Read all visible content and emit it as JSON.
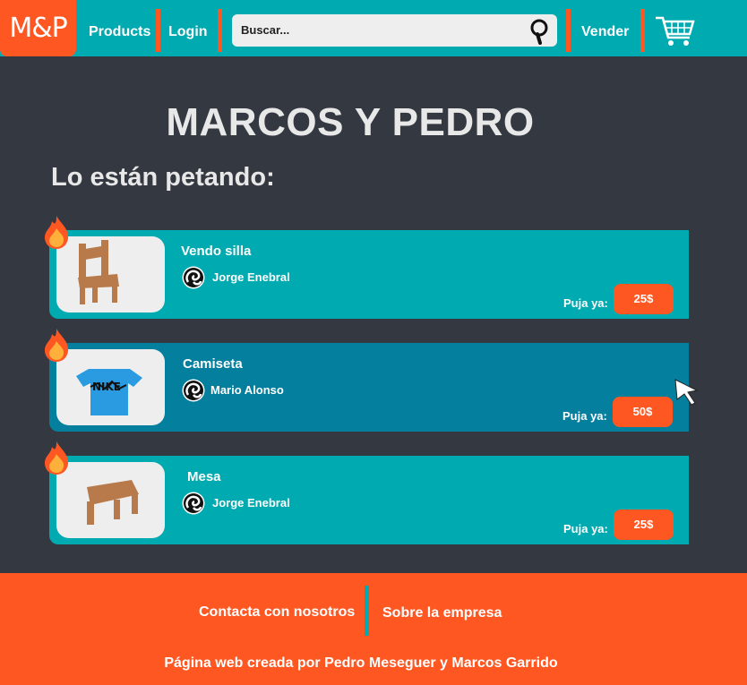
{
  "navbar": {
    "logo_text": "M&P",
    "links": {
      "products": "Products",
      "login": "Login",
      "sell": "Vender"
    },
    "search": {
      "placeholder": "Buscar..."
    },
    "icons": {
      "search": "search-icon",
      "cart": "cart-icon"
    },
    "colors": {
      "bar": "#00aab1",
      "accent": "#ff5722"
    }
  },
  "main": {
    "title": "MARCOS Y PEDRO",
    "subtitle": "Lo están petando:",
    "bid_label": "Puja ya:",
    "items": [
      {
        "title": "Vendo silla",
        "seller": "Jorge Enebral",
        "price": "25$",
        "image": "chair",
        "hovered": false
      },
      {
        "title": "Camiseta",
        "seller": "Mario Alonso",
        "price": "50$",
        "image": "nike-shirt",
        "hovered": true
      },
      {
        "title": "Mesa",
        "seller": "Jorge Enebral",
        "price": "25$",
        "image": "table",
        "hovered": false
      }
    ]
  },
  "footer": {
    "contact": "Contacta con nosotros",
    "about": "Sobre la empresa",
    "credits": "Página web creada por Pedro Meseguer y Marcos Garrido"
  }
}
